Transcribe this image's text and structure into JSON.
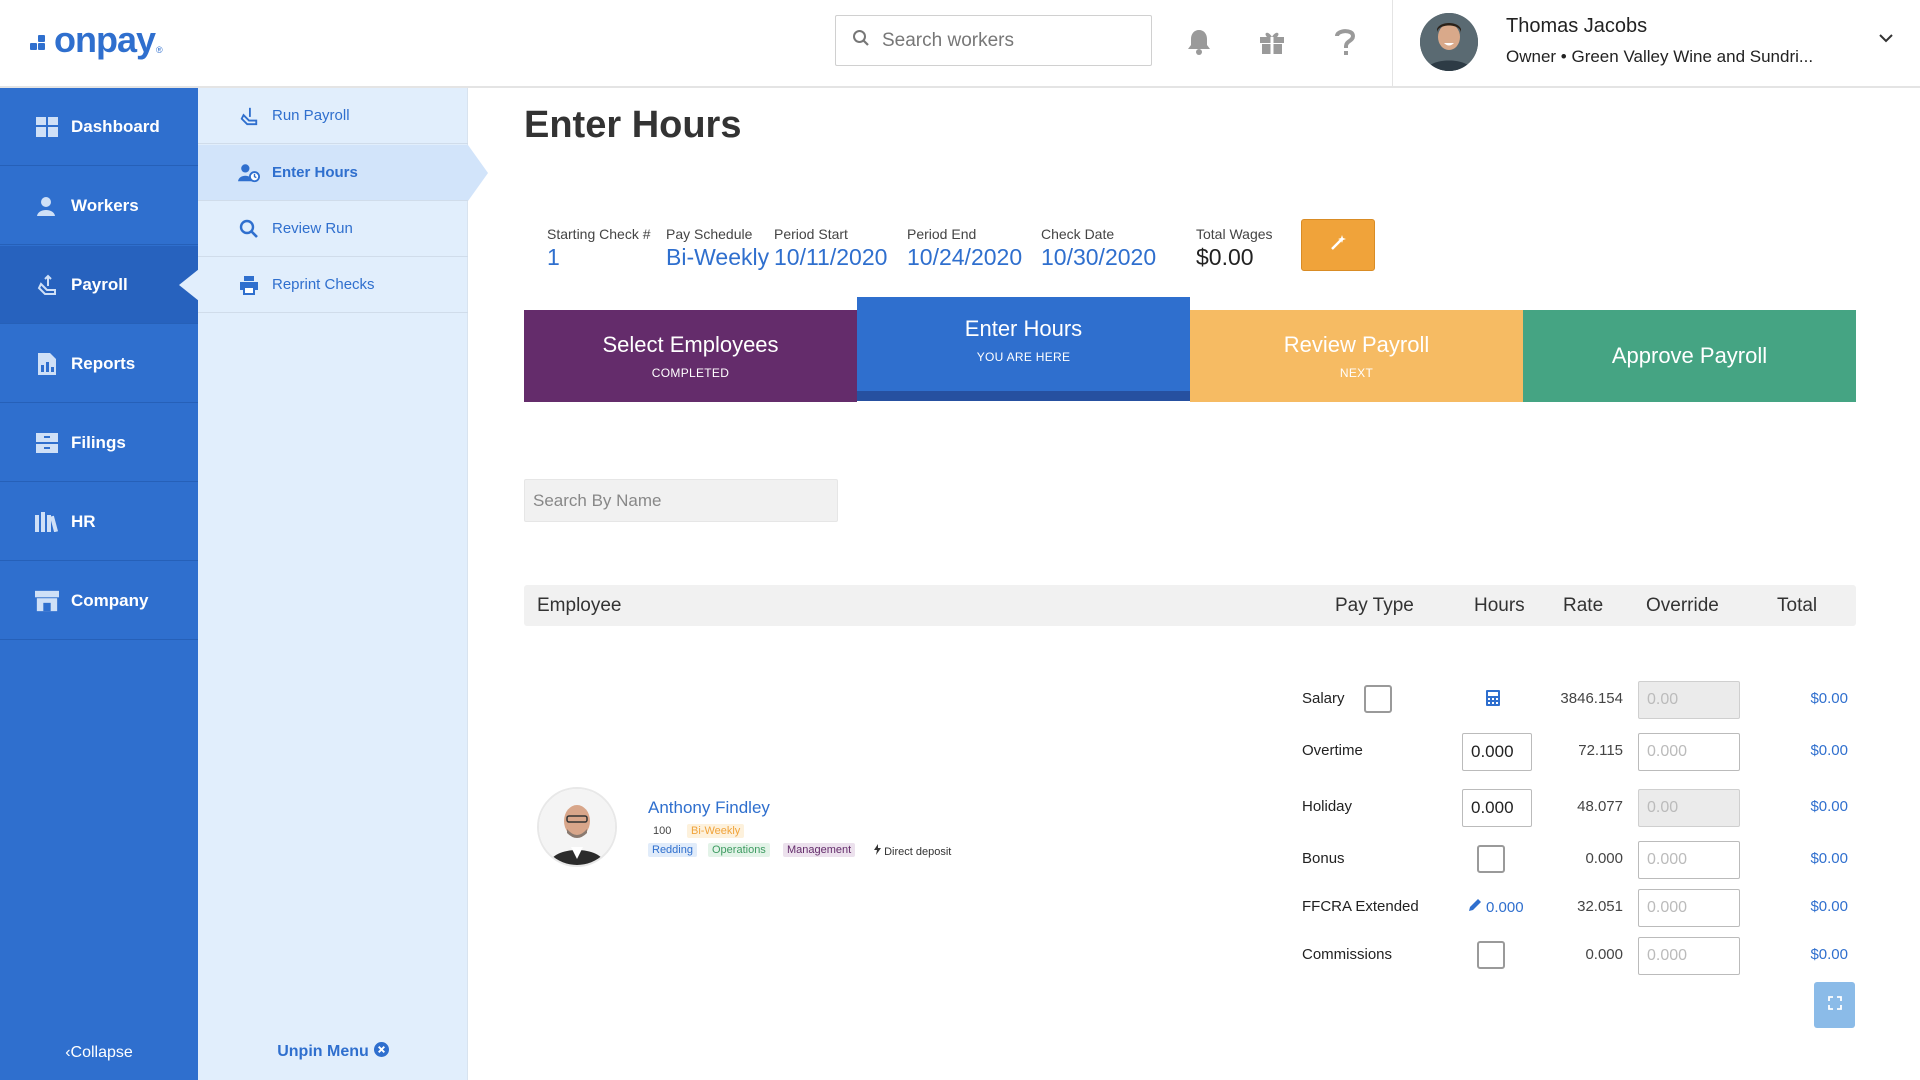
{
  "brand": {
    "logo_text": "onpay",
    "logo_reg": "®",
    "primary_color": "#2f6fce"
  },
  "topbar": {
    "search_placeholder": "Search workers",
    "icons": [
      "bell-icon",
      "gift-icon",
      "help-icon"
    ],
    "user": {
      "name": "Thomas Jacobs",
      "role": "Owner • Green Valley Wine and Sundri..."
    }
  },
  "sidebar": {
    "items": [
      {
        "label": "Dashboard",
        "icon": "dashboard-icon"
      },
      {
        "label": "Workers",
        "icon": "workers-icon"
      },
      {
        "label": "Payroll",
        "icon": "payroll-icon",
        "active": true
      },
      {
        "label": "Reports",
        "icon": "reports-icon"
      },
      {
        "label": "Filings",
        "icon": "filings-icon"
      },
      {
        "label": "HR",
        "icon": "hr-icon"
      },
      {
        "label": "Company",
        "icon": "company-icon"
      }
    ],
    "collapse_label": "Collapse"
  },
  "submenu": {
    "items": [
      {
        "label": "Run Payroll",
        "icon": "run-payroll-icon"
      },
      {
        "label": "Enter Hours",
        "icon": "enter-hours-icon",
        "active": true
      },
      {
        "label": "Review Run",
        "icon": "search-icon"
      },
      {
        "label": "Reprint Checks",
        "icon": "printer-icon"
      }
    ],
    "unpin_label": "Unpin Menu"
  },
  "page": {
    "title": "Enter Hours",
    "info": {
      "starting_check_label": "Starting Check #",
      "starting_check": "1",
      "pay_schedule_label": "Pay Schedule",
      "pay_schedule": "Bi-Weekly",
      "period_start_label": "Period Start",
      "period_start": "10/11/2020",
      "period_end_label": "Period End",
      "period_end": "10/24/2020",
      "check_date_label": "Check Date",
      "check_date": "10/30/2020",
      "total_wages_label": "Total Wages",
      "total_wages": "$0.00"
    },
    "steps": [
      {
        "title": "Select Employees",
        "sub": "COMPLETED",
        "color": "#642c6b"
      },
      {
        "title": "Enter Hours",
        "sub": "YOU ARE HERE",
        "color": "#2f6fce"
      },
      {
        "title": "Review Payroll",
        "sub": "NEXT",
        "color": "#f6bb63"
      },
      {
        "title": "Approve Payroll",
        "sub": "",
        "color": "#45a483"
      }
    ],
    "name_search_placeholder": "Search By Name",
    "table": {
      "headers": {
        "employee": "Employee",
        "pay_type": "Pay Type",
        "hours": "Hours",
        "rate": "Rate",
        "override": "Override",
        "total": "Total"
      }
    },
    "employee": {
      "name": "Anthony Findley",
      "id": "100",
      "schedule": "Bi-Weekly",
      "location": "Redding",
      "department": "Operations",
      "role": "Management",
      "deposit": "Direct deposit"
    },
    "pay_rows": [
      {
        "type": "Salary",
        "hours_kind": "checkbox+calculator",
        "rate": "3846.154",
        "override": "0.00",
        "override_disabled": true,
        "total": "$0.00"
      },
      {
        "type": "Overtime",
        "hours_kind": "input",
        "hours": "0.000",
        "rate": "72.115",
        "override": "0.000",
        "override_disabled": false,
        "total": "$0.00"
      },
      {
        "type": "Holiday",
        "hours_kind": "input",
        "hours": "0.000",
        "rate": "48.077",
        "override": "0.00",
        "override_disabled": true,
        "total": "$0.00"
      },
      {
        "type": "Bonus",
        "hours_kind": "checkbox",
        "rate": "0.000",
        "override": "0.000",
        "override_disabled": false,
        "total": "$0.00"
      },
      {
        "type": "FFCRA Extended",
        "hours_kind": "edit-link",
        "hours": "0.000",
        "rate": "32.051",
        "override": "0.000",
        "override_disabled": false,
        "total": "$0.00"
      },
      {
        "type": "Commissions",
        "hours_kind": "checkbox",
        "rate": "0.000",
        "override": "0.000",
        "override_disabled": false,
        "total": "$0.00"
      }
    ]
  }
}
